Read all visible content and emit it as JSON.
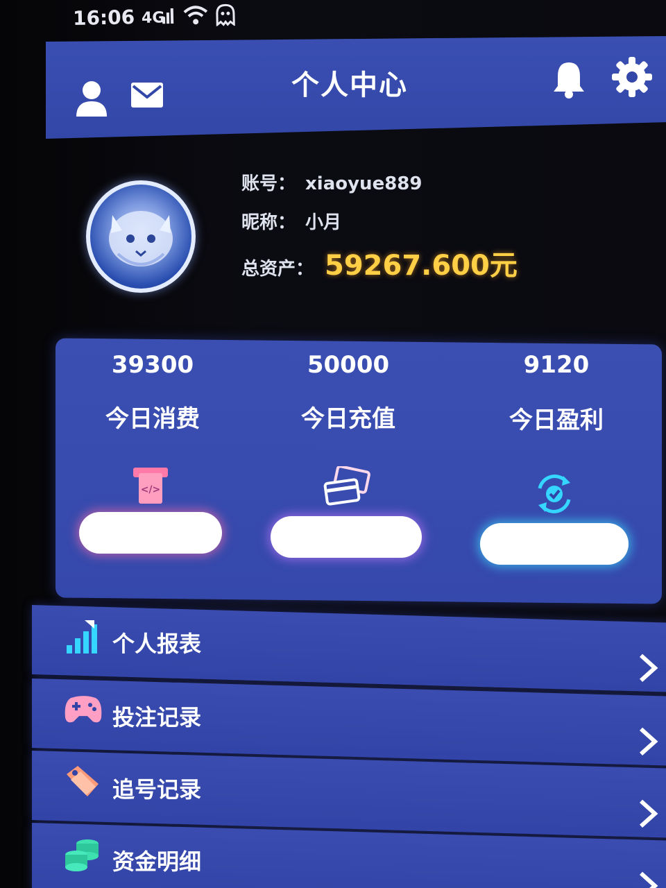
{
  "status_bar": {
    "time": "16:06",
    "icons": [
      "signal-icon",
      "wifi-icon",
      "ghost-icon"
    ]
  },
  "header": {
    "title": "个人中心",
    "left_icons": [
      "user-icon",
      "mail-icon"
    ],
    "right_icons": [
      "bell-icon",
      "gear-icon"
    ]
  },
  "profile": {
    "account_label": "账号：",
    "account_value": "xiaoyue889",
    "nickname_label": "昵称：",
    "nickname_value": "小月",
    "assets_label": "总资产：",
    "assets_value": "59267.600元"
  },
  "stats": [
    {
      "value": "39300",
      "label": "今日消费",
      "icon": "atm-icon",
      "button_glow": "#ff6eaa"
    },
    {
      "value": "50000",
      "label": "今日充值",
      "icon": "cards-icon",
      "button_glow": "#c878ff"
    },
    {
      "value": "9120",
      "label": "今日盈利",
      "icon": "cycle-check-icon",
      "button_glow": "#3cdcff"
    }
  ],
  "menu": [
    {
      "label": "个人报表",
      "icon": "bar-chart-icon"
    },
    {
      "label": "投注记录",
      "icon": "gamepad-icon"
    },
    {
      "label": "追号记录",
      "icon": "tag-icon"
    },
    {
      "label": "资金明细",
      "icon": "coins-icon"
    }
  ],
  "colors": {
    "panel_blue": "#3a4fb2",
    "accent_gold": "#ffcf45",
    "background": "#07070b"
  }
}
